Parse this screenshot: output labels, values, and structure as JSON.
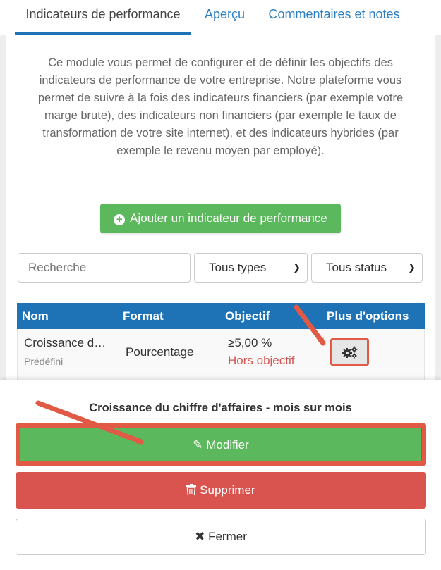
{
  "tabs": [
    {
      "label": "Indicateurs de performance",
      "active": true
    },
    {
      "label": "Aperçu",
      "active": false
    },
    {
      "label": "Commentaires et notes",
      "active": false
    }
  ],
  "description": "Ce module vous permet de configurer et de définir les objectifs des indicateurs de performance de votre entreprise. Notre plateforme vous permet de suivre à la fois des indicateurs financiers (par exemple votre marge brute), des indicateurs non financiers (par exemple le taux de transformation de votre site internet), et des indicateurs hybrides (par exemple le revenu moyen par employé).",
  "add_button_label": "Ajouter un indicateur de performance",
  "filters": {
    "search_placeholder": "Recherche",
    "type_selected": "Tous types",
    "status_selected": "Tous status"
  },
  "table": {
    "headers": [
      "Nom",
      "Format",
      "Objectif",
      "Plus d'options"
    ],
    "rows": [
      {
        "name": "Croissance d…",
        "sub": "Prédéfini",
        "format": "Pourcentage",
        "target": "≥5,00 %",
        "status": "Hors objectif"
      }
    ]
  },
  "sheet": {
    "title": "Croissance du chiffre d'affaires - mois sur mois",
    "edit_label": "Modifier",
    "delete_label": "Supprimer",
    "close_label": "Fermer"
  },
  "colors": {
    "primary": "#1d73b6",
    "success": "#5cb85c",
    "danger": "#d9534f",
    "annotation": "#e05a45"
  },
  "icons": [
    "plus-circle-icon",
    "chevron-down-icon",
    "gears-icon",
    "pencil-icon",
    "trash-icon",
    "times-icon",
    "annotation-arrow"
  ]
}
